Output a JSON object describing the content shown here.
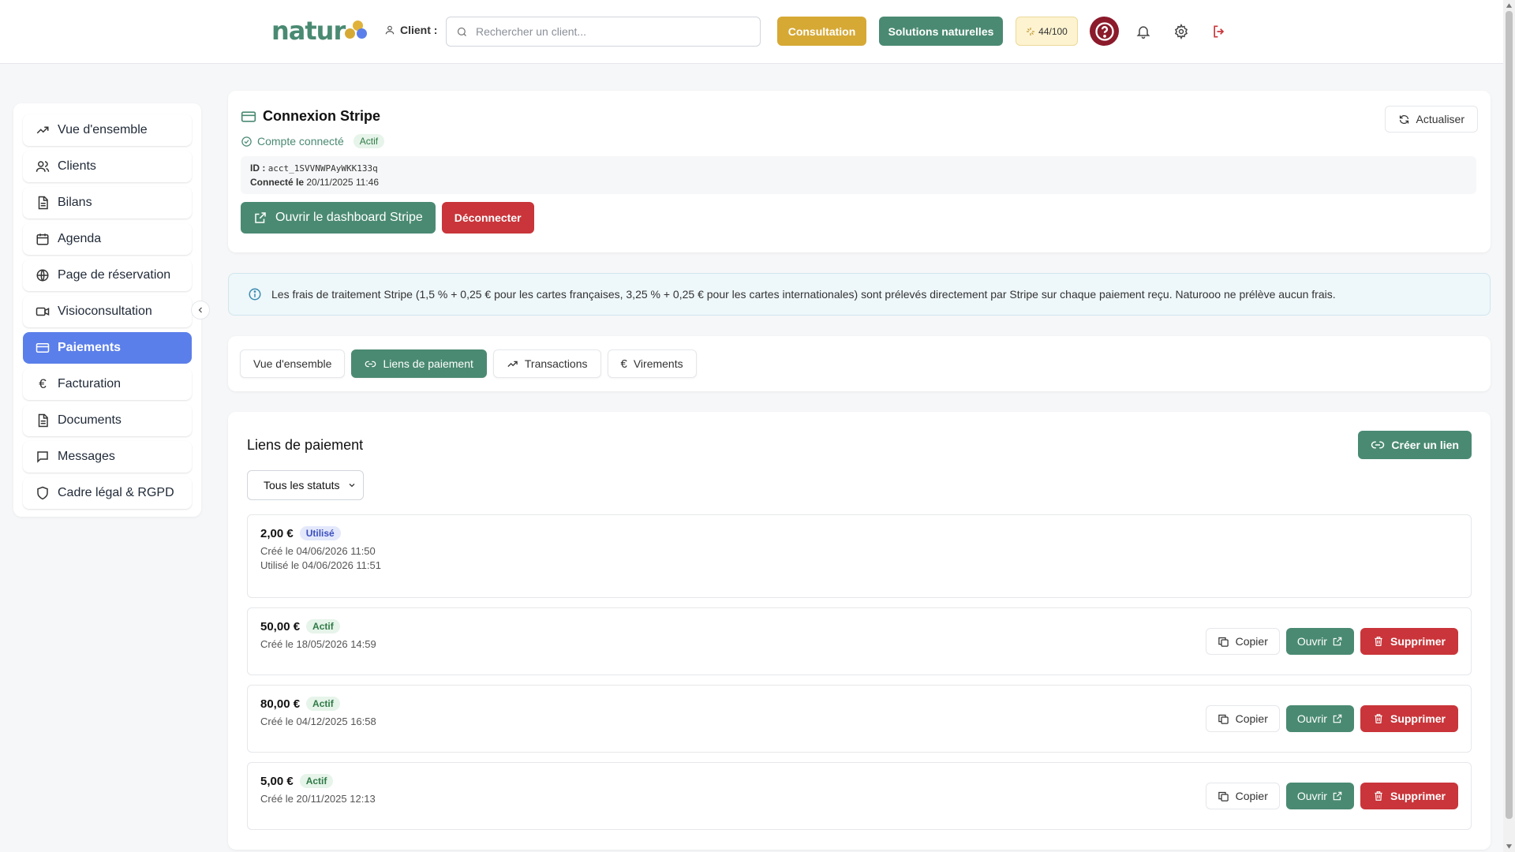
{
  "topbar": {
    "logo_text": "natur",
    "client_label": "Client :",
    "search_placeholder": "Rechercher un client...",
    "consultation_label": "Consultation",
    "solutions_label": "Solutions naturelles",
    "credits_label": "44/100",
    "icons": [
      "user-icon",
      "search-icon",
      "sparkle-icon",
      "help-icon",
      "bell-icon",
      "gear-icon",
      "logout-icon"
    ]
  },
  "sidebar": {
    "items": [
      {
        "label": "Vue d'ensemble",
        "icon": "trend-icon"
      },
      {
        "label": "Clients",
        "icon": "users-icon"
      },
      {
        "label": "Bilans",
        "icon": "file-icon"
      },
      {
        "label": "Agenda",
        "icon": "calendar-icon"
      },
      {
        "label": "Page de réservation",
        "icon": "globe-icon"
      },
      {
        "label": "Visioconsultation",
        "icon": "video-icon"
      },
      {
        "label": "Paiements",
        "icon": "card-icon",
        "active": true
      },
      {
        "label": "Facturation",
        "icon": "euro-icon"
      },
      {
        "label": "Documents",
        "icon": "file-icon"
      },
      {
        "label": "Messages",
        "icon": "message-icon"
      },
      {
        "label": "Cadre légal & RGPD",
        "icon": "shield-icon"
      }
    ]
  },
  "stripe": {
    "title": "Connexion Stripe",
    "connected_label": "Compte connecté",
    "status_badge": "Actif",
    "id_label": "ID :",
    "id_value": "acct_1SVVNWPAyWKK133q",
    "connected_on_label": "Connecté le",
    "connected_on_value": "20/11/2025 11:46",
    "open_dashboard_label": "Ouvrir le dashboard Stripe",
    "disconnect_label": "Déconnecter",
    "refresh_label": "Actualiser"
  },
  "info": {
    "text": "Les frais de traitement Stripe (1,5 % + 0,25 € pour les cartes françaises, 3,25 % + 0,25 € pour les cartes internationales) sont prélevés directement par Stripe sur chaque paiement reçu. Naturooo ne prélève aucun frais."
  },
  "tabs": [
    {
      "label": "Vue d'ensemble",
      "icon": ""
    },
    {
      "label": "Liens de paiement",
      "icon": "link-icon",
      "active": true
    },
    {
      "label": "Transactions",
      "icon": "trend-icon"
    },
    {
      "label": "Virements",
      "icon": "euro-icon"
    }
  ],
  "links": {
    "title": "Liens de paiement",
    "create_label": "Créer un lien",
    "status_filter": "Tous les statuts",
    "copy_label": "Copier",
    "open_label": "Ouvrir",
    "delete_label": "Supprimer",
    "rows": [
      {
        "amount": "2,00 €",
        "badge": "Utilisé",
        "created": "Créé le 04/06/2026 11:50",
        "used": "Utilisé le 04/06/2026 11:51"
      },
      {
        "amount": "50,00 €",
        "badge": "Actif",
        "created": "Créé le 18/05/2026 14:59"
      },
      {
        "amount": "80,00 €",
        "badge": "Actif",
        "created": "Créé le 04/12/2025 16:58"
      },
      {
        "amount": "5,00 €",
        "badge": "Actif",
        "created": "Créé le 20/11/2025 12:13"
      }
    ]
  },
  "colors": {
    "brand_teal": "#4a8a72",
    "accent_gold": "#d6a935",
    "active_nav": "#5b7fea",
    "danger": "#c9353a"
  }
}
